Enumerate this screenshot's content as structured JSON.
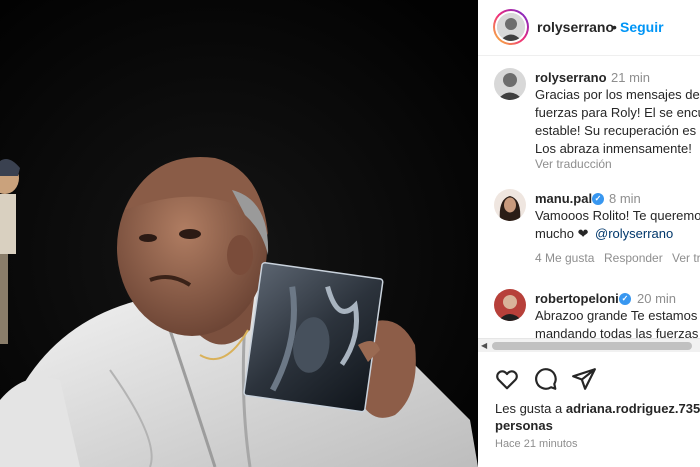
{
  "post": {
    "username": "rolyserrano",
    "separator": "•",
    "follow_label": "Seguir"
  },
  "comments": [
    {
      "username": "rolyserrano",
      "time": "21 min",
      "lines": [
        "Gracias por los mensajes de",
        "fuerzas para Roly! El se encu",
        "estable! Su recuperación es",
        "Los abraza inmensamente!"
      ],
      "translate_label": "Ver traducción"
    },
    {
      "username": "manu.pal",
      "verified": true,
      "time": "8 min",
      "lines": [
        "Vamooos Rolito! Te queremo",
        "mucho ❤"
      ],
      "mention": "@rolyserrano",
      "likes_label": "4 Me gusta",
      "reply_label": "Responder",
      "translate_label": "Ver tr"
    },
    {
      "username": "robertopeloni",
      "verified": true,
      "time": "20 min",
      "lines": [
        "Abrazoo grande Te estamos",
        "mandando todas las fuerzas"
      ]
    }
  ],
  "actions": {
    "like_icon": "heart-icon",
    "comment_icon": "comment-icon",
    "share_icon": "share-icon"
  },
  "footer": {
    "liked_by_prefix": "Les gusta a",
    "liked_by_user": "adriana.rodriguez.735",
    "liked_by_suffix": "personas",
    "time_ago": "Hace 21 minutos"
  }
}
